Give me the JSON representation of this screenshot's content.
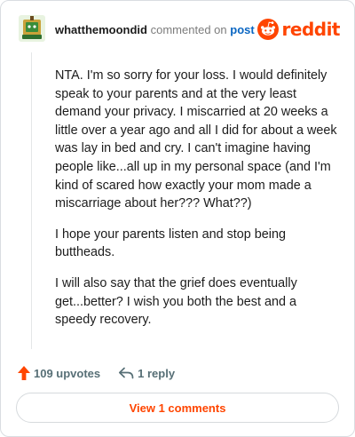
{
  "header": {
    "author": "whatthemoondid",
    "action_text": "commented on",
    "post_link": "post",
    "brand": "reddit"
  },
  "comment": {
    "paragraphs": [
      "NTA. I'm so sorry for your loss. I would definitely speak to your parents and at the very least demand your privacy. I miscarried at 20 weeks a little over a year ago and all I did for about a week was lay in bed and cry. I can't imagine having people like...all up in my personal space (and I'm kind of scared how exactly your mom made a miscarriage about her??? What??)",
      "I hope your parents listen and stop being buttheads.",
      "I will also say that the grief does eventually get...better? I wish you both the best and a speedy recovery."
    ]
  },
  "actions": {
    "upvotes": "109 upvotes",
    "replies": "1 reply"
  },
  "footer": {
    "view_comments": "View 1 comments"
  },
  "colors": {
    "brand": "#ff4500",
    "link": "#0a66c2",
    "muted": "#576f76"
  },
  "icons": {
    "avatar": "snoo-avatar",
    "brand": "reddit-snoo-icon",
    "upvote": "upvote-arrow-icon",
    "reply": "reply-arrow-icon"
  }
}
